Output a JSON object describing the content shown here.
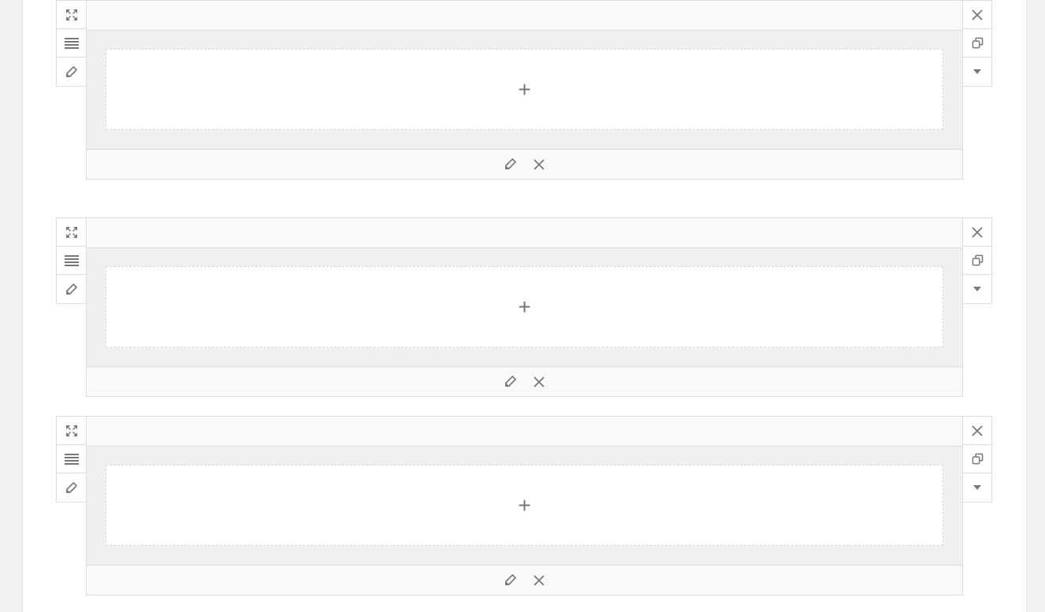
{
  "icons": {
    "left_controls": [
      "expand-icon",
      "layout-lines-icon",
      "pencil-icon"
    ],
    "right_controls": [
      "close-icon",
      "duplicate-icon",
      "caret-down-icon"
    ],
    "footer_controls": [
      "pencil-icon",
      "close-icon"
    ],
    "add": "plus-icon"
  },
  "colors": {
    "icon": "#777777",
    "border": "#dddddd",
    "body_bg": "#f0f0f0",
    "header_bg": "#f9f9f9",
    "page_bg": "#f1f1f1"
  },
  "rows": [
    {
      "add_label": "+"
    },
    {
      "add_label": "+"
    },
    {
      "add_label": "+"
    }
  ]
}
